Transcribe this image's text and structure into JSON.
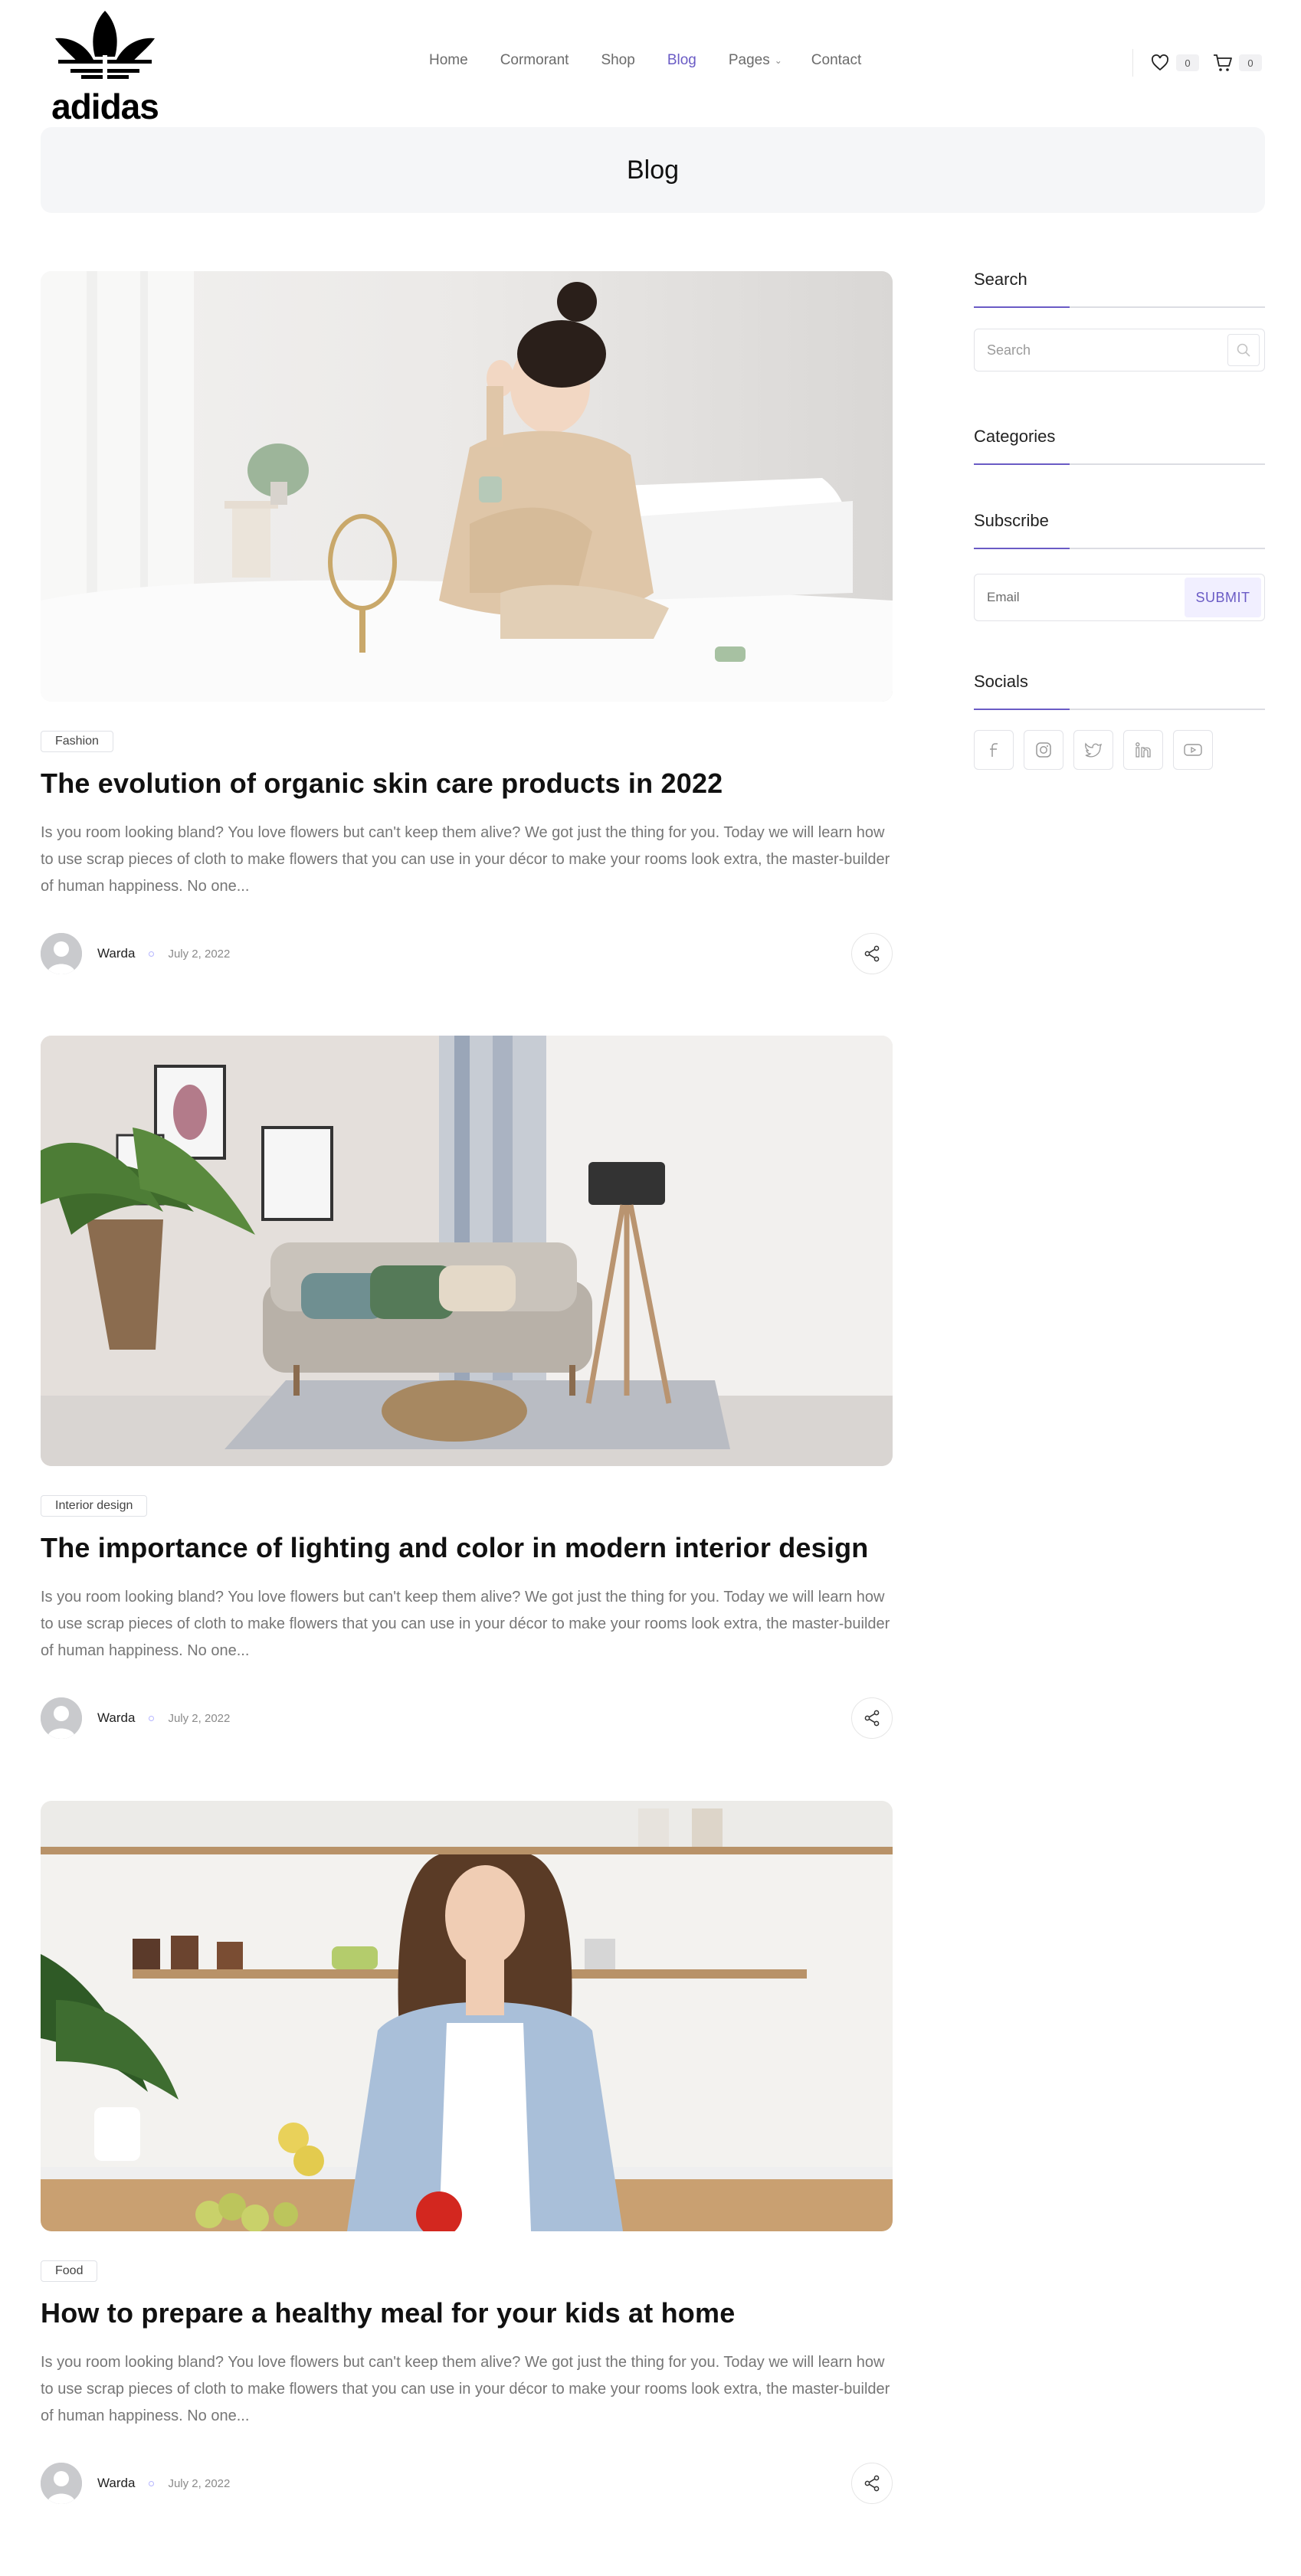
{
  "brand": {
    "logo_text": "adidas"
  },
  "nav": {
    "items": [
      {
        "label": "Home"
      },
      {
        "label": "Cormorant"
      },
      {
        "label": "Shop"
      },
      {
        "label": "Blog"
      },
      {
        "label": "Pages"
      },
      {
        "label": "Contact"
      }
    ],
    "active_label": "Blog"
  },
  "header": {
    "wishlist_count": "0",
    "cart_count": "0",
    "icons": {
      "wishlist": "heart-icon",
      "cart": "cart-icon"
    }
  },
  "page": {
    "title": "Blog"
  },
  "posts": [
    {
      "tag": "Fashion",
      "title": "The evolution of organic skin care products in 2022",
      "excerpt": "Is you room looking bland? You love flowers but can't keep them alive? We got just the thing for you. Today we will learn how to use scrap pieces of cloth to make flowers that you can use in your décor to make your rooms look extra, the master-builder of human happiness. No one...",
      "author": "Warda",
      "date": "July 2, 2022"
    },
    {
      "tag": "Interior design",
      "title": "The importance of lighting and color in modern interior design",
      "excerpt": "Is you room looking bland? You love flowers but can't keep them alive? We got just the thing for you. Today we will learn how to use scrap pieces of cloth to make flowers that you can use in your décor to make your rooms look extra, the master-builder of human happiness. No one...",
      "author": "Warda",
      "date": "July 2, 2022"
    },
    {
      "tag": "Food",
      "title": "How to prepare a healthy meal for your kids at home",
      "excerpt": "Is you room looking bland? You love flowers but can't keep them alive? We got just the thing for you. Today we will learn how to use scrap pieces of cloth to make flowers that you can use in your décor to make your rooms look extra, the master-builder of human happiness. No one...",
      "author": "Warda",
      "date": "July 2, 2022"
    }
  ],
  "sidebar": {
    "search": {
      "title": "Search",
      "placeholder": "Search"
    },
    "categories": {
      "title": "Categories"
    },
    "subscribe": {
      "title": "Subscribe",
      "placeholder": "Email",
      "button": "SUBMIT"
    },
    "socials": {
      "title": "Socials",
      "icons": [
        "facebook-icon",
        "instagram-icon",
        "twitter-icon",
        "linkedin-icon",
        "youtube-icon"
      ]
    }
  },
  "colors": {
    "accent": "#6a5bc5",
    "panel": "#f5f6f8",
    "text_muted": "#767676"
  }
}
